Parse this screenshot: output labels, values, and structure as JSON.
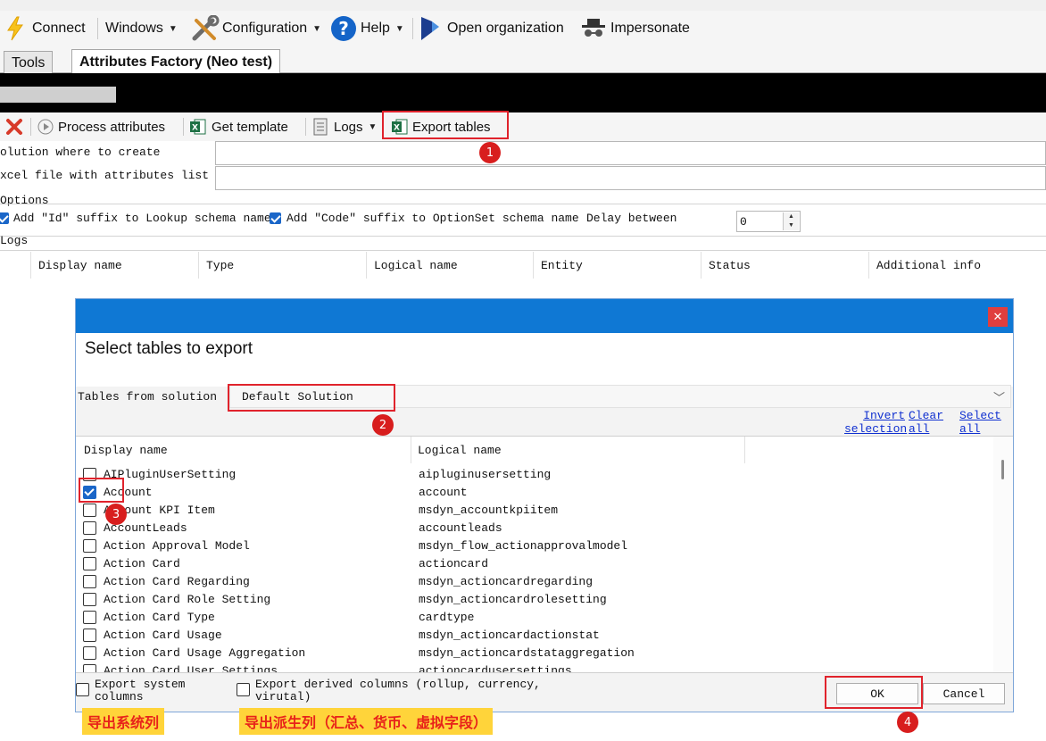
{
  "menu": {
    "connect": "Connect",
    "windows": "Windows",
    "configuration": "Configuration",
    "help": "Help",
    "open_org": "Open organization",
    "impersonate": "Impersonate"
  },
  "tabs": [
    "Tools",
    "Attributes Factory (Neo test)"
  ],
  "plugin_toolbar": {
    "process": "Process attributes",
    "template": "Get template",
    "logs": "Logs",
    "export": "Export tables"
  },
  "form": {
    "solution_label": "olution where to create",
    "excel_label": "xcel file with attributes list",
    "options_label": "Options",
    "opt_id": "Add \"Id\" suffix to Lookup schema name",
    "opt_code": "Add \"Code\" suffix to OptionSet schema name",
    "delay_label": "Delay between",
    "delay_value": "0",
    "logs_label": "Logs"
  },
  "log_columns": [
    "Display name",
    "Type",
    "Logical name",
    "Entity",
    "Status",
    "Additional info"
  ],
  "dialog": {
    "heading": "Select tables to export",
    "tables_label": "Tables from solution",
    "solution_value": "Default Solution",
    "invert_line1": "Invert",
    "invert_line2": "selection",
    "clear_line1": "Clear",
    "clear_line2": "all",
    "select_line1": "Select",
    "select_line2": "all",
    "col_display": "Display name",
    "col_logical": "Logical name",
    "rows": [
      {
        "display": "AIPluginUserSetting",
        "logical": "aipluginusersetting",
        "checked": false
      },
      {
        "display": "Account",
        "logical": "account",
        "checked": true
      },
      {
        "display": "Account KPI Item",
        "logical": "msdyn_accountkpiitem",
        "checked": false
      },
      {
        "display": "AccountLeads",
        "logical": "accountleads",
        "checked": false
      },
      {
        "display": "Action Approval Model",
        "logical": "msdyn_flow_actionapprovalmodel",
        "checked": false
      },
      {
        "display": "Action Card",
        "logical": "actioncard",
        "checked": false
      },
      {
        "display": "Action Card Regarding",
        "logical": "msdyn_actioncardregarding",
        "checked": false
      },
      {
        "display": "Action Card Role Setting",
        "logical": "msdyn_actioncardrolesetting",
        "checked": false
      },
      {
        "display": "Action Card Type",
        "logical": "cardtype",
        "checked": false
      },
      {
        "display": "Action Card Usage",
        "logical": "msdyn_actioncardactionstat",
        "checked": false
      },
      {
        "display": "Action Card Usage Aggregation",
        "logical": "msdyn_actioncardstataggregation",
        "checked": false
      },
      {
        "display": "Action Card User Settings",
        "logical": "actioncardusersettings",
        "checked": false
      }
    ],
    "export_system_line1": "Export system",
    "export_system_line2": "columns",
    "export_derived_line1": "Export derived columns (rollup, currency,",
    "export_derived_line2": "virutal)",
    "ok": "OK",
    "cancel": "Cancel"
  },
  "annotations": {
    "n1": "1",
    "n2": "2",
    "n3": "3",
    "n4": "4",
    "note_system": "导出系统列",
    "note_derived": "导出派生列（汇总、货币、虚拟字段）"
  },
  "colors": {
    "dialog_title": "#0f78d4",
    "annotation_red": "#e0232c",
    "note_yellow": "#ffd43a",
    "checkbox_blue": "#1a66c8"
  }
}
